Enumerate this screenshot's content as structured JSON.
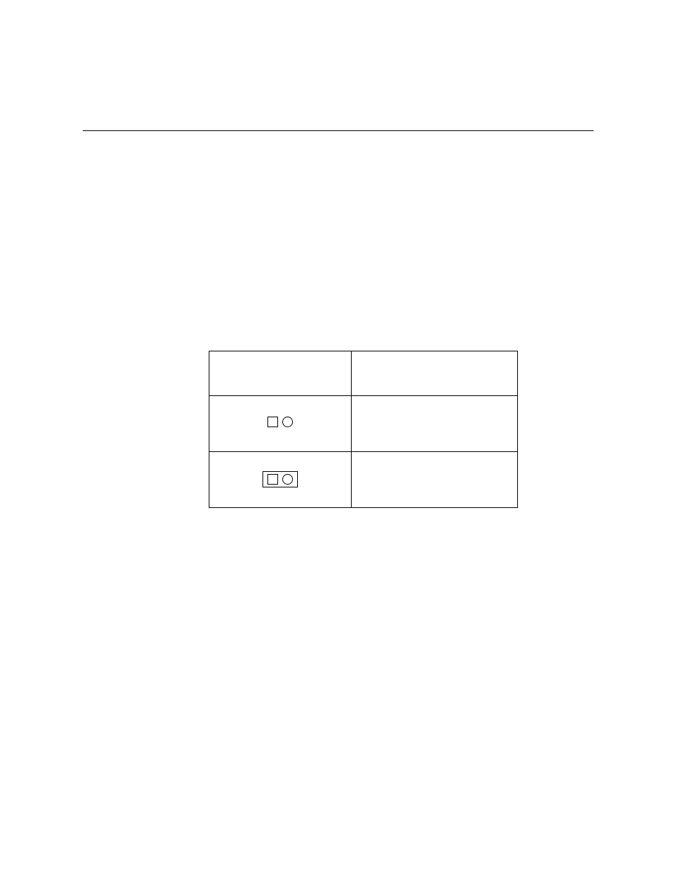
{
  "table": {
    "header": {
      "setting": "",
      "config": ""
    },
    "rows": [
      {
        "setting_label": "",
        "config_label": ""
      },
      {
        "setting_label": "",
        "config_label": ""
      }
    ]
  }
}
